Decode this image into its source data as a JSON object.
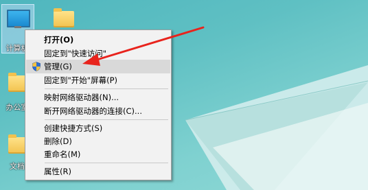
{
  "desktop": {
    "icons": [
      {
        "label": "计算机"
      },
      {
        "label": ""
      },
      {
        "label": "办公室"
      },
      {
        "label": "文档"
      }
    ]
  },
  "context_menu": {
    "items": [
      {
        "label": "打开(O)",
        "bold": true
      },
      {
        "label": "固定到\"快速访问\""
      },
      {
        "label": "管理(G)",
        "icon": "uac-shield-icon"
      },
      {
        "label": "固定到\"开始\"屏幕(P)"
      },
      {
        "label": "映射网络驱动器(N)..."
      },
      {
        "label": "断开网络驱动器的连接(C)..."
      },
      {
        "label": "创建快捷方式(S)"
      },
      {
        "label": "删除(D)"
      },
      {
        "label": "重命名(M)"
      },
      {
        "label": "属性(R)"
      }
    ]
  },
  "colors": {
    "arrow": "#e8231c",
    "menu_bg": "#f2f2f2",
    "highlight": "#d9d9d9"
  }
}
